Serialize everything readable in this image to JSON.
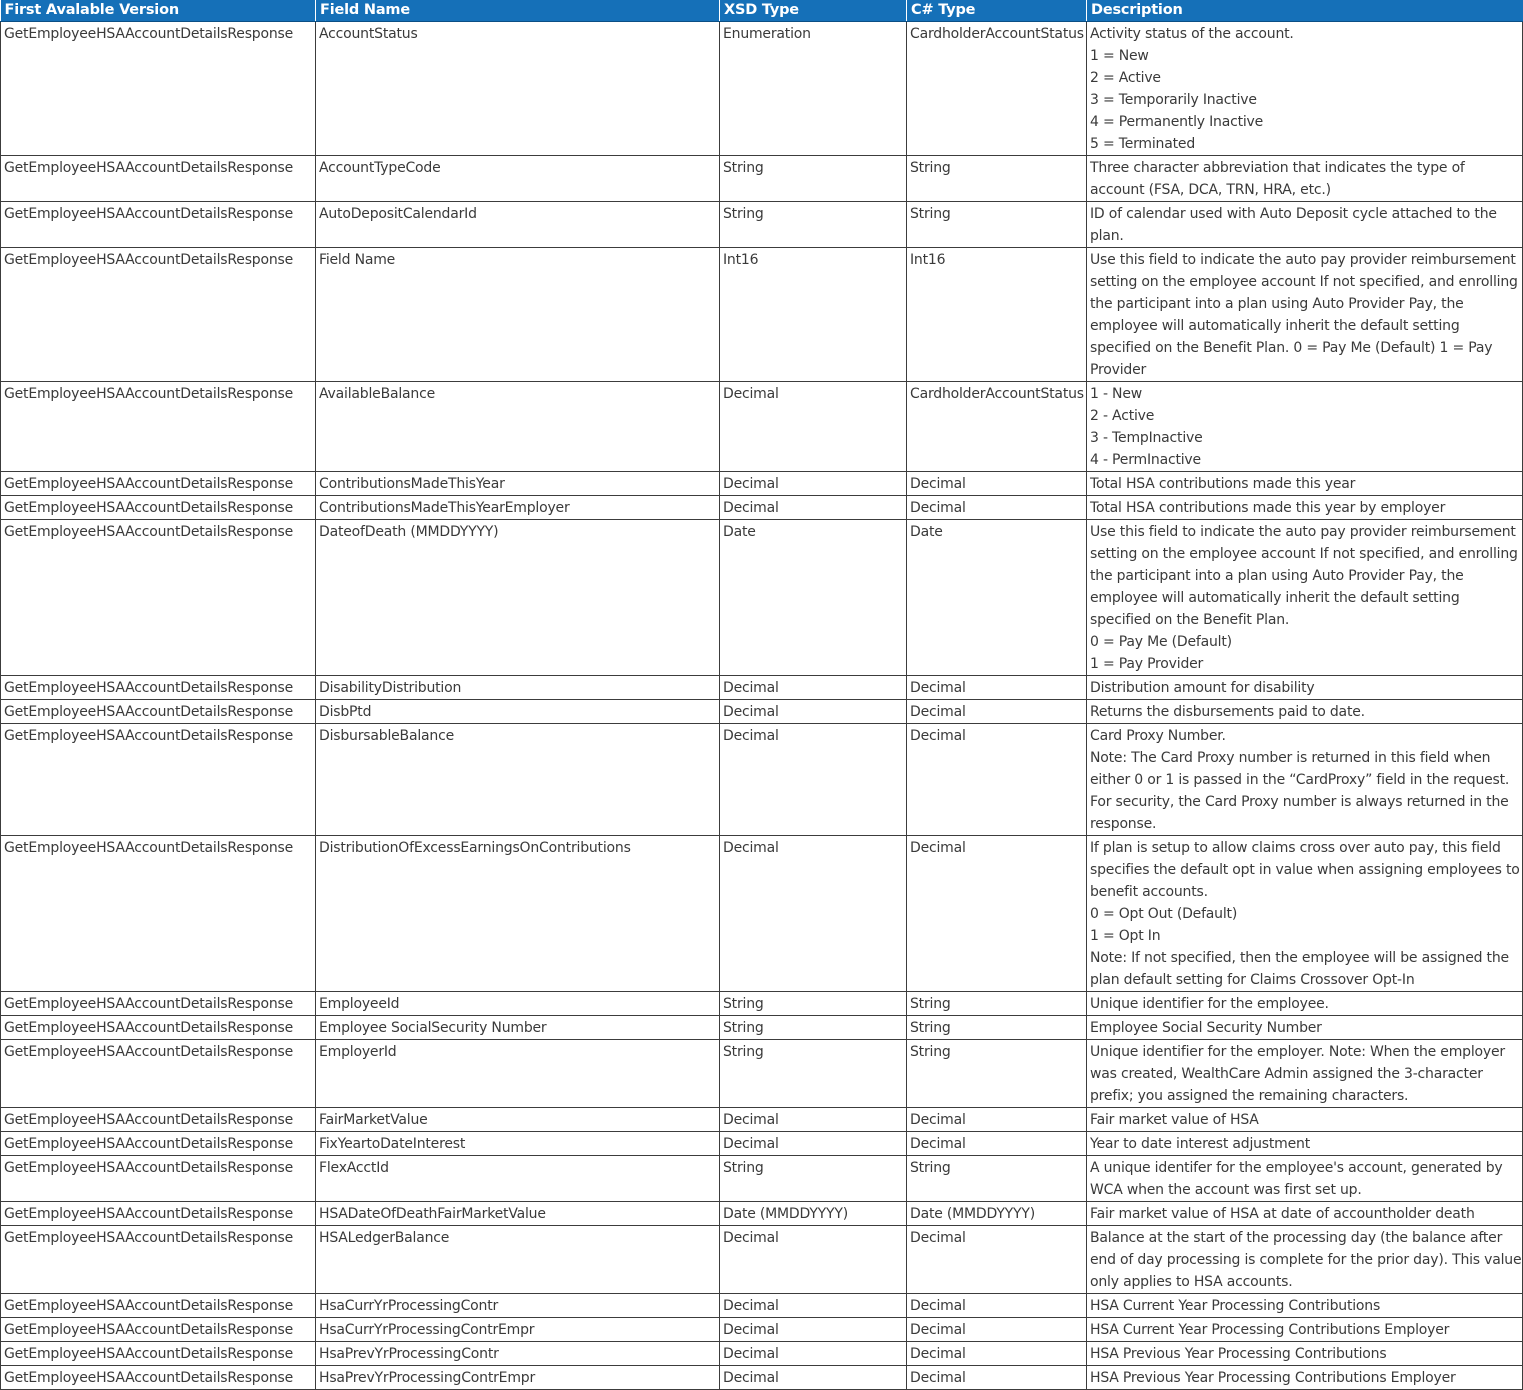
{
  "headers": [
    "First Avalable Version",
    "Field Name",
    "XSD Type",
    "C# Type",
    "Description"
  ],
  "rows": [
    {
      "version": "GetEmployeeHSAAccountDetailsResponse",
      "field": "AccountStatus",
      "xsd": "Enumeration",
      "csharp": "CardholderAccountStatus",
      "description": [
        "Activity status of the account.",
        "1 = New",
        "2 = Active",
        "3 = Temporarily Inactive",
        "4 = Permanently Inactive",
        "5 = Terminated"
      ]
    },
    {
      "version": "GetEmployeeHSAAccountDetailsResponse",
      "field": "AccountTypeCode",
      "xsd": "String",
      "csharp": "String",
      "description": [
        "Three character abbreviation that indicates the type of account (FSA, DCA, TRN, HRA, etc.)"
      ]
    },
    {
      "version": "GetEmployeeHSAAccountDetailsResponse",
      "field": "AutoDepositCalendarId",
      "xsd": "String",
      "csharp": "String",
      "description": [
        "ID of calendar used with Auto Deposit cycle attached to the plan."
      ]
    },
    {
      "version": "GetEmployeeHSAAccountDetailsResponse",
      "field": "Field Name",
      "xsd": "Int16",
      "csharp": "Int16",
      "description": [
        "Use this field to indicate the auto pay provider reimbursement setting on the employee account If not specified, and enrolling the participant into a plan using Auto Provider Pay, the employee will automatically inherit the default setting specified on the Benefit Plan. 0 = Pay Me (Default) 1 = Pay Provider"
      ]
    },
    {
      "version": "GetEmployeeHSAAccountDetailsResponse",
      "field": "AvailableBalance",
      "xsd": "Decimal",
      "csharp": "CardholderAccountStatus",
      "description": [
        "1 - New",
        "2 - Active",
        "3 - TempInactive",
        "4 - PermInactive"
      ]
    },
    {
      "version": "GetEmployeeHSAAccountDetailsResponse",
      "field": "ContributionsMadeThisYear",
      "xsd": "Decimal",
      "csharp": "Decimal",
      "description": [
        "Total HSA contributions made this year"
      ]
    },
    {
      "version": "GetEmployeeHSAAccountDetailsResponse",
      "field": "ContributionsMadeThisYearEmployer",
      "xsd": "Decimal",
      "csharp": "Decimal",
      "description": [
        "Total HSA contributions made this year by employer"
      ]
    },
    {
      "version": "GetEmployeeHSAAccountDetailsResponse",
      "field": "DateofDeath (MMDDYYYY)",
      "xsd": "Date",
      "csharp": "Date",
      "description": [
        "Use this field to indicate the auto pay provider reimbursement setting on the employee account If not specified, and enrolling the participant into a plan using Auto Provider Pay, the employee will automatically inherit the default setting specified on the Benefit Plan.",
        "0 = Pay Me (Default)",
        "1 = Pay Provider"
      ]
    },
    {
      "version": "GetEmployeeHSAAccountDetailsResponse",
      "field": "DisabilityDistribution",
      "xsd": "Decimal",
      "csharp": "Decimal",
      "description": [
        "Distribution amount for disability"
      ]
    },
    {
      "version": "GetEmployeeHSAAccountDetailsResponse",
      "field": "DisbPtd",
      "xsd": "Decimal",
      "csharp": "Decimal",
      "description": [
        "Returns the disbursements paid to date."
      ]
    },
    {
      "version": "GetEmployeeHSAAccountDetailsResponse",
      "field": "DisbursableBalance",
      "xsd": "Decimal",
      "csharp": "Decimal",
      "description": [
        "Card Proxy Number.",
        "Note: The Card Proxy number is returned in this field when either 0 or 1 is passed in the “CardProxy” field in the request. For security, the Card Proxy number is always returned in the response."
      ]
    },
    {
      "version": "GetEmployeeHSAAccountDetailsResponse",
      "field": "DistributionOfExcessEarningsOnContributions",
      "xsd": "Decimal",
      "csharp": "Decimal",
      "description": [
        "If plan is setup to allow claims cross over auto pay, this field specifies the default opt in value when assigning employees to benefit accounts.",
        "0 = Opt Out (Default)",
        "1 = Opt In",
        "Note: If not specified, then the employee will be assigned the plan default setting for Claims Crossover Opt-In"
      ]
    },
    {
      "version": "GetEmployeeHSAAccountDetailsResponse",
      "field": "EmployeeId",
      "xsd": "String",
      "csharp": "String",
      "description": [
        "Unique identifier for the employee."
      ]
    },
    {
      "version": "GetEmployeeHSAAccountDetailsResponse",
      "field": "Employee SocialSecurity Number",
      "xsd": "String",
      "csharp": "String",
      "description": [
        "Employee Social Security Number"
      ]
    },
    {
      "version": "GetEmployeeHSAAccountDetailsResponse",
      "field": "EmployerId",
      "xsd": "String",
      "csharp": "String",
      "description": [
        "Unique identifier for the employer. Note: When the employer was created, WealthCare Admin assigned the 3-character prefix; you assigned the remaining characters."
      ]
    },
    {
      "version": "GetEmployeeHSAAccountDetailsResponse",
      "field": "FairMarketValue",
      "xsd": "Decimal",
      "csharp": "Decimal",
      "description": [
        "Fair market value of HSA"
      ]
    },
    {
      "version": "GetEmployeeHSAAccountDetailsResponse",
      "field": "FixYeartoDateInterest",
      "xsd": "Decimal",
      "csharp": "Decimal",
      "description": [
        "Year to date interest adjustment"
      ]
    },
    {
      "version": "GetEmployeeHSAAccountDetailsResponse",
      "field": "FlexAcctId",
      "xsd": "String",
      "csharp": "String",
      "description": [
        "A unique identifer for the employee's account, generated by WCA when the account was first set up."
      ]
    },
    {
      "version": "GetEmployeeHSAAccountDetailsResponse",
      "field": "HSADateOfDeathFairMarketValue",
      "xsd": "Date (MMDDYYYY)",
      "csharp": "Date (MMDDYYYY)",
      "description": [
        "Fair market value of HSA at date of accountholder death"
      ]
    },
    {
      "version": "GetEmployeeHSAAccountDetailsResponse",
      "field": "HSALedgerBalance",
      "xsd": "Decimal",
      "csharp": "Decimal",
      "description": [
        "Balance at the start of the processing day (the balance after end of day processing is complete for the prior day).  This value only applies to HSA accounts."
      ]
    },
    {
      "version": "GetEmployeeHSAAccountDetailsResponse",
      "field": "HsaCurrYrProcessingContr",
      "xsd": "Decimal",
      "csharp": "Decimal",
      "description": [
        "HSA Current Year Processing Contributions"
      ]
    },
    {
      "version": "GetEmployeeHSAAccountDetailsResponse",
      "field": "HsaCurrYrProcessingContrEmpr",
      "xsd": "Decimal",
      "csharp": "Decimal",
      "description": [
        "HSA Current Year Processing Contributions Employer"
      ]
    },
    {
      "version": "GetEmployeeHSAAccountDetailsResponse",
      "field": "HsaPrevYrProcessingContr",
      "xsd": "Decimal",
      "csharp": "Decimal",
      "description": [
        "HSA Previous Year Processing Contributions"
      ]
    },
    {
      "version": "GetEmployeeHSAAccountDetailsResponse",
      "field": "HsaPrevYrProcessingContrEmpr",
      "xsd": "Decimal",
      "csharp": "Decimal",
      "description": [
        "HSA Previous Year Processing Contributions Employer"
      ]
    }
  ]
}
